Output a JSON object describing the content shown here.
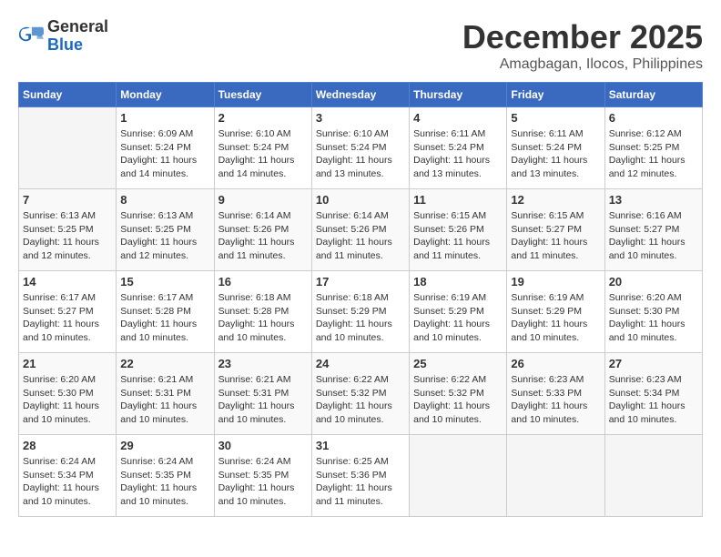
{
  "header": {
    "logo_general": "General",
    "logo_blue": "Blue",
    "month_title": "December 2025",
    "location": "Amagbagan, Ilocos, Philippines"
  },
  "weekdays": [
    "Sunday",
    "Monday",
    "Tuesday",
    "Wednesday",
    "Thursday",
    "Friday",
    "Saturday"
  ],
  "weeks": [
    [
      {
        "day": "",
        "sunrise": "",
        "sunset": "",
        "daylight": ""
      },
      {
        "day": "1",
        "sunrise": "Sunrise: 6:09 AM",
        "sunset": "Sunset: 5:24 PM",
        "daylight": "Daylight: 11 hours and 14 minutes."
      },
      {
        "day": "2",
        "sunrise": "Sunrise: 6:10 AM",
        "sunset": "Sunset: 5:24 PM",
        "daylight": "Daylight: 11 hours and 14 minutes."
      },
      {
        "day": "3",
        "sunrise": "Sunrise: 6:10 AM",
        "sunset": "Sunset: 5:24 PM",
        "daylight": "Daylight: 11 hours and 13 minutes."
      },
      {
        "day": "4",
        "sunrise": "Sunrise: 6:11 AM",
        "sunset": "Sunset: 5:24 PM",
        "daylight": "Daylight: 11 hours and 13 minutes."
      },
      {
        "day": "5",
        "sunrise": "Sunrise: 6:11 AM",
        "sunset": "Sunset: 5:24 PM",
        "daylight": "Daylight: 11 hours and 13 minutes."
      },
      {
        "day": "6",
        "sunrise": "Sunrise: 6:12 AM",
        "sunset": "Sunset: 5:25 PM",
        "daylight": "Daylight: 11 hours and 12 minutes."
      }
    ],
    [
      {
        "day": "7",
        "sunrise": "Sunrise: 6:13 AM",
        "sunset": "Sunset: 5:25 PM",
        "daylight": "Daylight: 11 hours and 12 minutes."
      },
      {
        "day": "8",
        "sunrise": "Sunrise: 6:13 AM",
        "sunset": "Sunset: 5:25 PM",
        "daylight": "Daylight: 11 hours and 12 minutes."
      },
      {
        "day": "9",
        "sunrise": "Sunrise: 6:14 AM",
        "sunset": "Sunset: 5:26 PM",
        "daylight": "Daylight: 11 hours and 11 minutes."
      },
      {
        "day": "10",
        "sunrise": "Sunrise: 6:14 AM",
        "sunset": "Sunset: 5:26 PM",
        "daylight": "Daylight: 11 hours and 11 minutes."
      },
      {
        "day": "11",
        "sunrise": "Sunrise: 6:15 AM",
        "sunset": "Sunset: 5:26 PM",
        "daylight": "Daylight: 11 hours and 11 minutes."
      },
      {
        "day": "12",
        "sunrise": "Sunrise: 6:15 AM",
        "sunset": "Sunset: 5:27 PM",
        "daylight": "Daylight: 11 hours and 11 minutes."
      },
      {
        "day": "13",
        "sunrise": "Sunrise: 6:16 AM",
        "sunset": "Sunset: 5:27 PM",
        "daylight": "Daylight: 11 hours and 10 minutes."
      }
    ],
    [
      {
        "day": "14",
        "sunrise": "Sunrise: 6:17 AM",
        "sunset": "Sunset: 5:27 PM",
        "daylight": "Daylight: 11 hours and 10 minutes."
      },
      {
        "day": "15",
        "sunrise": "Sunrise: 6:17 AM",
        "sunset": "Sunset: 5:28 PM",
        "daylight": "Daylight: 11 hours and 10 minutes."
      },
      {
        "day": "16",
        "sunrise": "Sunrise: 6:18 AM",
        "sunset": "Sunset: 5:28 PM",
        "daylight": "Daylight: 11 hours and 10 minutes."
      },
      {
        "day": "17",
        "sunrise": "Sunrise: 6:18 AM",
        "sunset": "Sunset: 5:29 PM",
        "daylight": "Daylight: 11 hours and 10 minutes."
      },
      {
        "day": "18",
        "sunrise": "Sunrise: 6:19 AM",
        "sunset": "Sunset: 5:29 PM",
        "daylight": "Daylight: 11 hours and 10 minutes."
      },
      {
        "day": "19",
        "sunrise": "Sunrise: 6:19 AM",
        "sunset": "Sunset: 5:29 PM",
        "daylight": "Daylight: 11 hours and 10 minutes."
      },
      {
        "day": "20",
        "sunrise": "Sunrise: 6:20 AM",
        "sunset": "Sunset: 5:30 PM",
        "daylight": "Daylight: 11 hours and 10 minutes."
      }
    ],
    [
      {
        "day": "21",
        "sunrise": "Sunrise: 6:20 AM",
        "sunset": "Sunset: 5:30 PM",
        "daylight": "Daylight: 11 hours and 10 minutes."
      },
      {
        "day": "22",
        "sunrise": "Sunrise: 6:21 AM",
        "sunset": "Sunset: 5:31 PM",
        "daylight": "Daylight: 11 hours and 10 minutes."
      },
      {
        "day": "23",
        "sunrise": "Sunrise: 6:21 AM",
        "sunset": "Sunset: 5:31 PM",
        "daylight": "Daylight: 11 hours and 10 minutes."
      },
      {
        "day": "24",
        "sunrise": "Sunrise: 6:22 AM",
        "sunset": "Sunset: 5:32 PM",
        "daylight": "Daylight: 11 hours and 10 minutes."
      },
      {
        "day": "25",
        "sunrise": "Sunrise: 6:22 AM",
        "sunset": "Sunset: 5:32 PM",
        "daylight": "Daylight: 11 hours and 10 minutes."
      },
      {
        "day": "26",
        "sunrise": "Sunrise: 6:23 AM",
        "sunset": "Sunset: 5:33 PM",
        "daylight": "Daylight: 11 hours and 10 minutes."
      },
      {
        "day": "27",
        "sunrise": "Sunrise: 6:23 AM",
        "sunset": "Sunset: 5:34 PM",
        "daylight": "Daylight: 11 hours and 10 minutes."
      }
    ],
    [
      {
        "day": "28",
        "sunrise": "Sunrise: 6:24 AM",
        "sunset": "Sunset: 5:34 PM",
        "daylight": "Daylight: 11 hours and 10 minutes."
      },
      {
        "day": "29",
        "sunrise": "Sunrise: 6:24 AM",
        "sunset": "Sunset: 5:35 PM",
        "daylight": "Daylight: 11 hours and 10 minutes."
      },
      {
        "day": "30",
        "sunrise": "Sunrise: 6:24 AM",
        "sunset": "Sunset: 5:35 PM",
        "daylight": "Daylight: 11 hours and 10 minutes."
      },
      {
        "day": "31",
        "sunrise": "Sunrise: 6:25 AM",
        "sunset": "Sunset: 5:36 PM",
        "daylight": "Daylight: 11 hours and 11 minutes."
      },
      {
        "day": "",
        "sunrise": "",
        "sunset": "",
        "daylight": ""
      },
      {
        "day": "",
        "sunrise": "",
        "sunset": "",
        "daylight": ""
      },
      {
        "day": "",
        "sunrise": "",
        "sunset": "",
        "daylight": ""
      }
    ]
  ]
}
